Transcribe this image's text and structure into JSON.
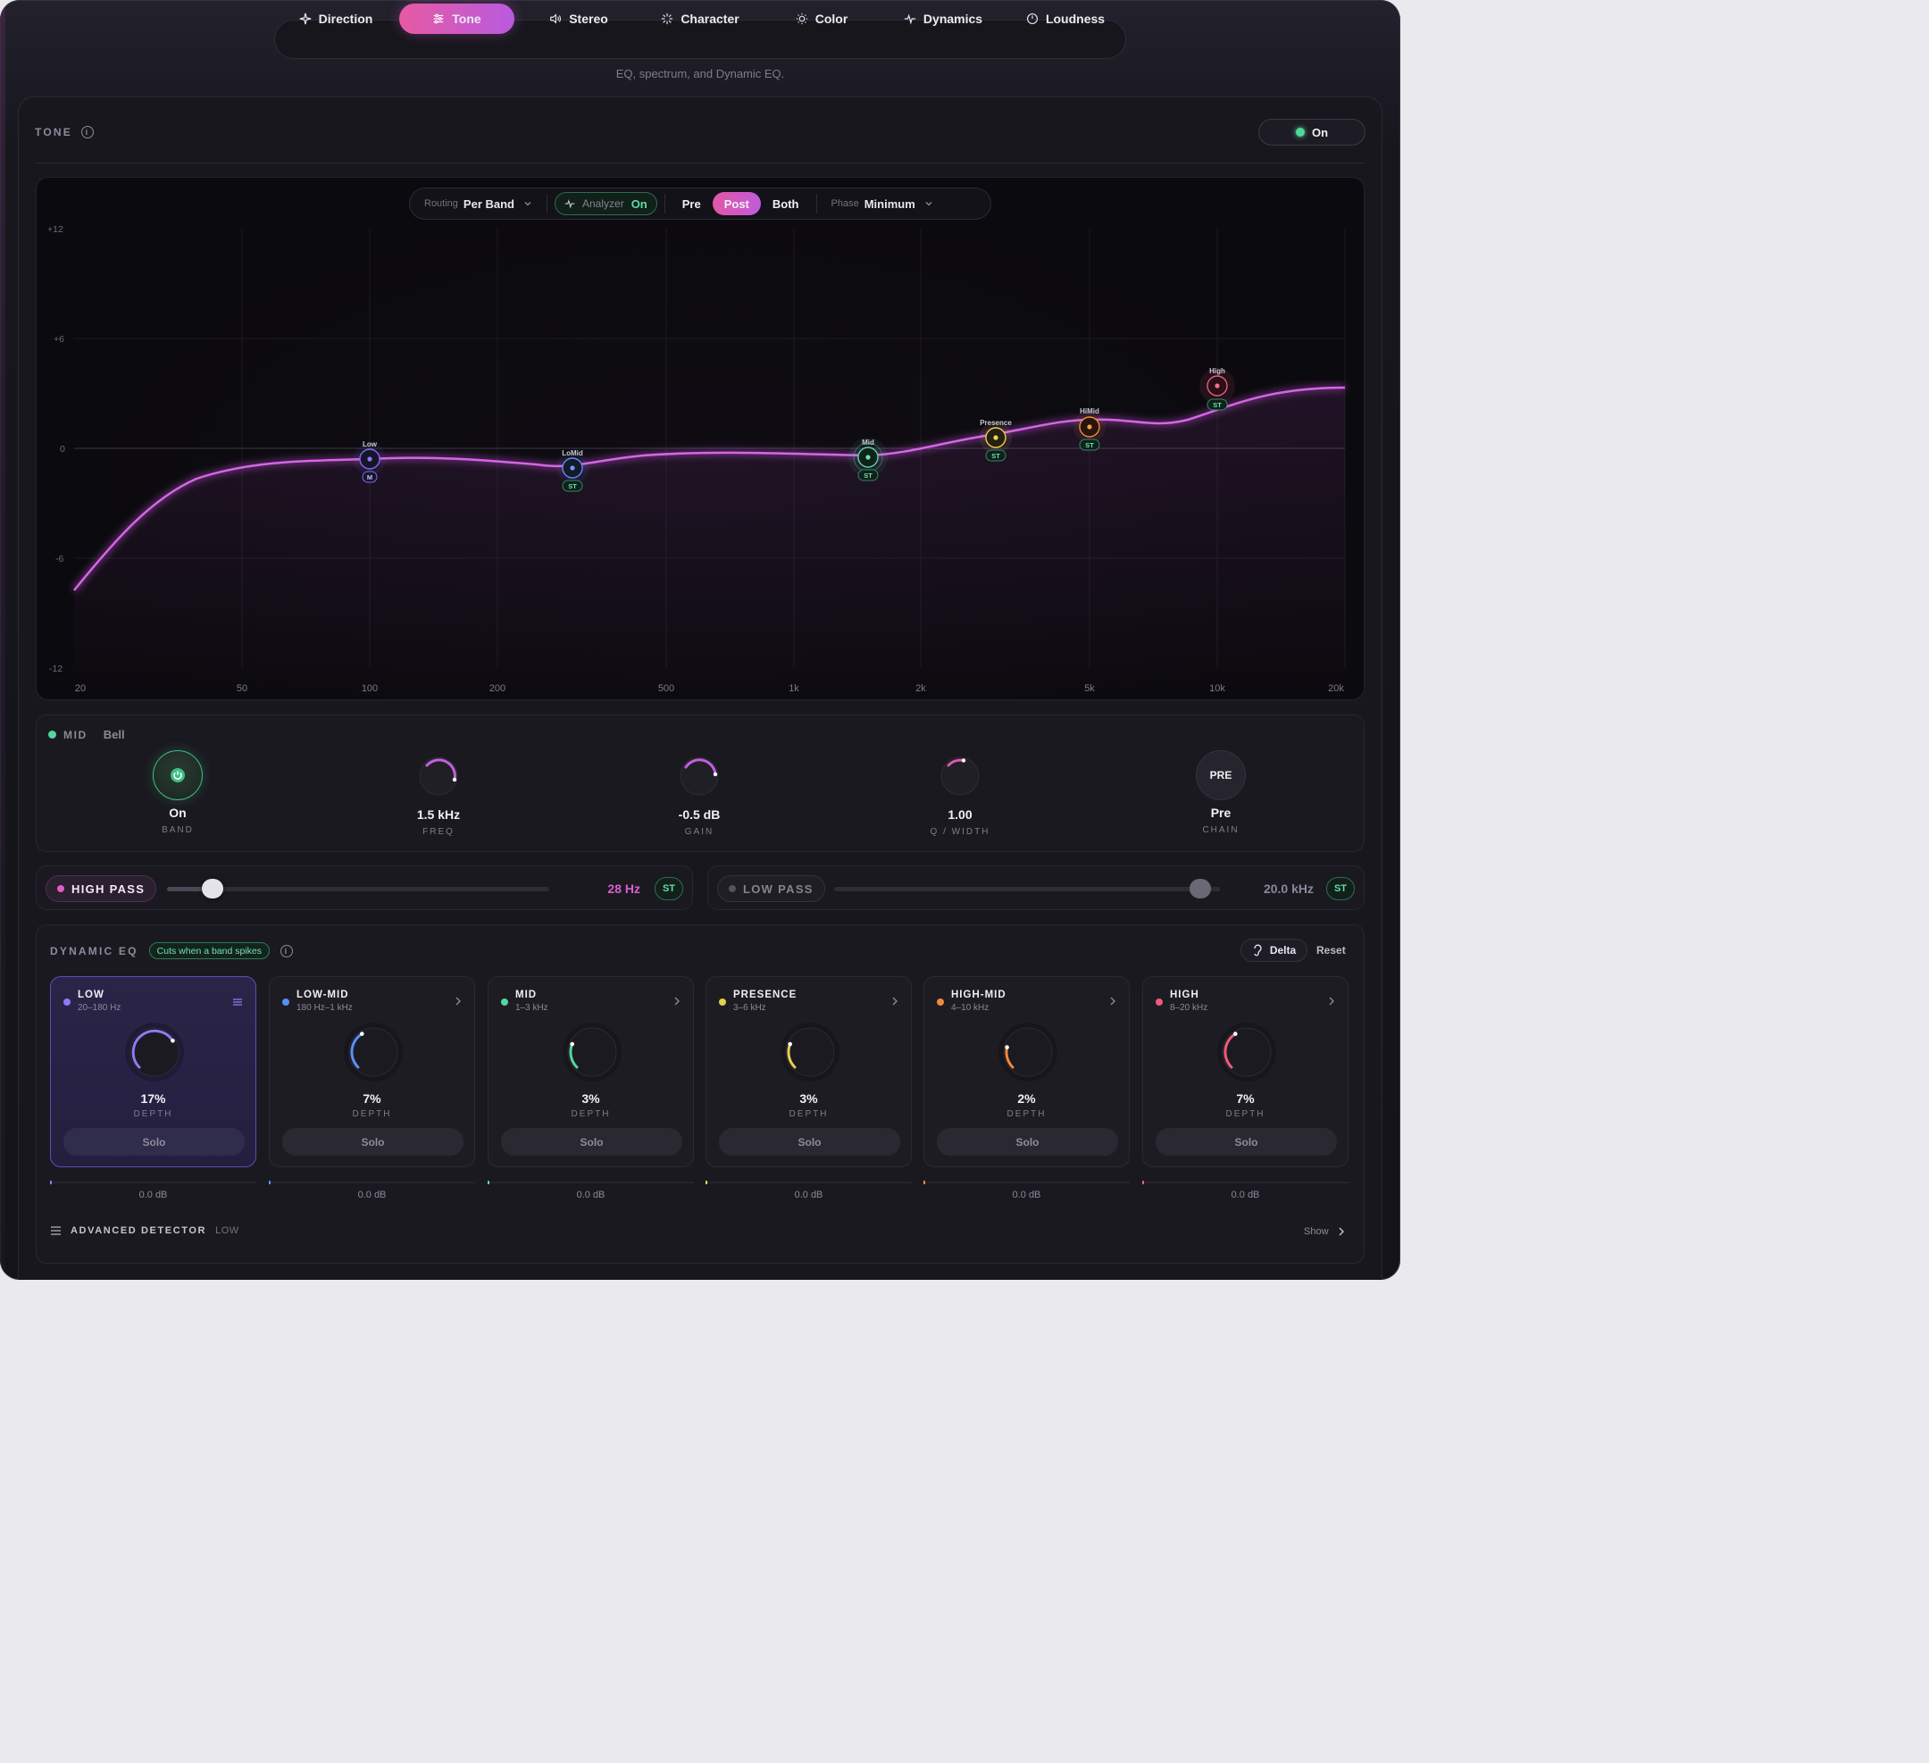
{
  "nav": {
    "tabs": [
      {
        "label": "Direction",
        "icon": "sparkle-icon"
      },
      {
        "label": "Tone",
        "icon": "sliders-icon",
        "active": true
      },
      {
        "label": "Stereo",
        "icon": "speaker-icon"
      },
      {
        "label": "Character",
        "icon": "burst-icon"
      },
      {
        "label": "Color",
        "icon": "sun-icon"
      },
      {
        "label": "Dynamics",
        "icon": "pulse-icon"
      },
      {
        "label": "Loudness",
        "icon": "meter-icon"
      }
    ],
    "subtitle": "EQ, spectrum, and Dynamic EQ."
  },
  "tone": {
    "label": "TONE",
    "on_label": "On"
  },
  "toolbar": {
    "routing_label": "Routing",
    "routing_value": "Per Band",
    "analyzer_label": "Analyzer",
    "analyzer_value": "On",
    "pre": "Pre",
    "post": "Post",
    "both": "Both",
    "active_mode": "Post",
    "phase_label": "Phase",
    "phase_value": "Minimum"
  },
  "graph": {
    "y_ticks": [
      "+12",
      "+6",
      "0",
      "-6",
      "-12"
    ],
    "x_ticks": [
      "20",
      "50",
      "100",
      "200",
      "500",
      "1k",
      "2k",
      "5k",
      "10k",
      "20k"
    ],
    "nodes": [
      {
        "name": "Low",
        "badge": "M",
        "color": "#7b6cf0"
      },
      {
        "name": "LoMid",
        "badge": "ST",
        "color": "#5b8ef5"
      },
      {
        "name": "Mid",
        "badge": "ST",
        "color": "#52d6a0"
      },
      {
        "name": "Presence",
        "badge": "ST",
        "color": "#e6cf4e"
      },
      {
        "name": "HiMid",
        "badge": "ST",
        "color": "#f08a3c"
      },
      {
        "name": "High",
        "badge": "ST",
        "color": "#ef5a78"
      }
    ]
  },
  "band": {
    "name": "MID",
    "type": "Bell",
    "band_value": "On",
    "band_cap": "BAND",
    "freq_value": "1.5 kHz",
    "freq_cap": "FREQ",
    "gain_value": "-0.5 dB",
    "gain_cap": "GAIN",
    "q_value": "1.00",
    "q_cap": "Q / WIDTH",
    "chain_knob": "PRE",
    "chain_value": "Pre",
    "chain_cap": "CHAIN"
  },
  "filters": {
    "hp_label": "HIGH PASS",
    "hp_value": "28 Hz",
    "hp_position": 0.12,
    "lp_label": "LOW PASS",
    "lp_value": "20.0 kHz",
    "lp_position": 0.95,
    "st": "ST"
  },
  "dynamic_eq": {
    "title": "DYNAMIC EQ",
    "badge": "Cuts when a band spikes",
    "delta": "Delta",
    "reset": "Reset",
    "depth_cap": "DEPTH",
    "solo": "Solo",
    "bands": [
      {
        "name": "LOW",
        "range": "20–180 Hz",
        "depth": "17%",
        "depth_value": 0.17,
        "db": "0.0 dB",
        "color": "#8b7bf5"
      },
      {
        "name": "LOW-MID",
        "range": "180 Hz–1 kHz",
        "depth": "7%",
        "depth_value": 0.07,
        "db": "0.0 dB",
        "color": "#5b8ef5"
      },
      {
        "name": "MID",
        "range": "1–3 kHz",
        "depth": "3%",
        "depth_value": 0.03,
        "db": "0.0 dB",
        "color": "#52d6a0"
      },
      {
        "name": "PRESENCE",
        "range": "3–6 kHz",
        "depth": "3%",
        "depth_value": 0.03,
        "db": "0.0 dB",
        "color": "#e6cf4e"
      },
      {
        "name": "HIGH-MID",
        "range": "4–10 kHz",
        "depth": "2%",
        "depth_value": 0.02,
        "db": "0.0 dB",
        "color": "#f08a3c"
      },
      {
        "name": "HIGH",
        "range": "8–20 kHz",
        "depth": "7%",
        "depth_value": 0.07,
        "db": "0.0 dB",
        "color": "#ef5a78"
      }
    ],
    "advanced_label": "ADVANCED DETECTOR",
    "advanced_band": "LOW",
    "show": "Show"
  }
}
